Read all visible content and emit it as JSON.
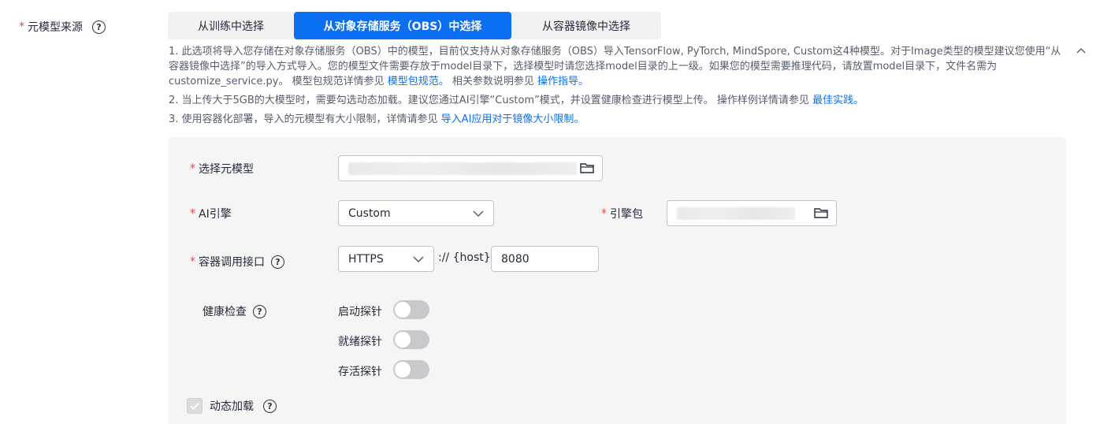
{
  "source": {
    "label": "元模型来源",
    "help_icon": "question-circle-icon"
  },
  "tabs": [
    {
      "label": "从训练中选择",
      "selected": false
    },
    {
      "label": "从对象存储服务（OBS）中选择",
      "selected": true
    },
    {
      "label": "从容器镜像中选择",
      "selected": false
    }
  ],
  "notes": {
    "n1_text_a": "1. 此选项将导入您存储在对象存储服务（OBS）中的模型，目前仅支持从对象存储服务（OBS）导入TensorFlow, PyTorch, MindSpore, Custom这4种模型。对于Image类型的模型建议您使用“从容器镜像中选择”的导入方式导入。您的模型文件需要存放于model目录下，选择模型时请您选择model目录的上一级。如果您的模型需要推理代码，请放置model目录下，文件名需为customize_service.py。 模型包规范详情参见 ",
    "n1_link_a": "模型包规范。",
    "n1_text_b": " 相关参数说明参见 ",
    "n1_link_b": "操作指导。",
    "n2_text": "2. 当上传大于5GB的大模型时，需要勾选动态加载。建议您通过AI引擎“Custom”模式，并设置健康检查进行模型上传。 操作样例详情请参见 ",
    "n2_link": "最佳实践。",
    "n3_text": "3. 使用容器化部署，导入的元模型有大小限制，详情请参见 ",
    "n3_link": "导入AI应用对于镜像大小限制。",
    "collapse_icon": "chevron-up-icon"
  },
  "form": {
    "meta_model": {
      "label": "选择元模型",
      "icon": "folder-icon"
    },
    "ai_engine": {
      "label": "AI引擎",
      "value": "Custom",
      "icon": "chevron-down-icon"
    },
    "engine_pkg": {
      "label": "引擎包",
      "icon": "folder-icon"
    },
    "api": {
      "label": "容器调用接口",
      "protocol": "HTTPS",
      "host_text": ":// {host} :",
      "port": "8080"
    },
    "health": {
      "label": "健康检查",
      "startup": {
        "label": "启动探针",
        "on": false
      },
      "readiness": {
        "label": "就绪探针",
        "on": false
      },
      "liveness": {
        "label": "存活探针",
        "on": false
      }
    },
    "dynamic_load": {
      "label": "动态加载",
      "checked": true,
      "disabled": true
    }
  },
  "colors": {
    "primary": "#0a6ff2",
    "required": "#e5484d",
    "panel_bg": "#f5f5f6"
  }
}
